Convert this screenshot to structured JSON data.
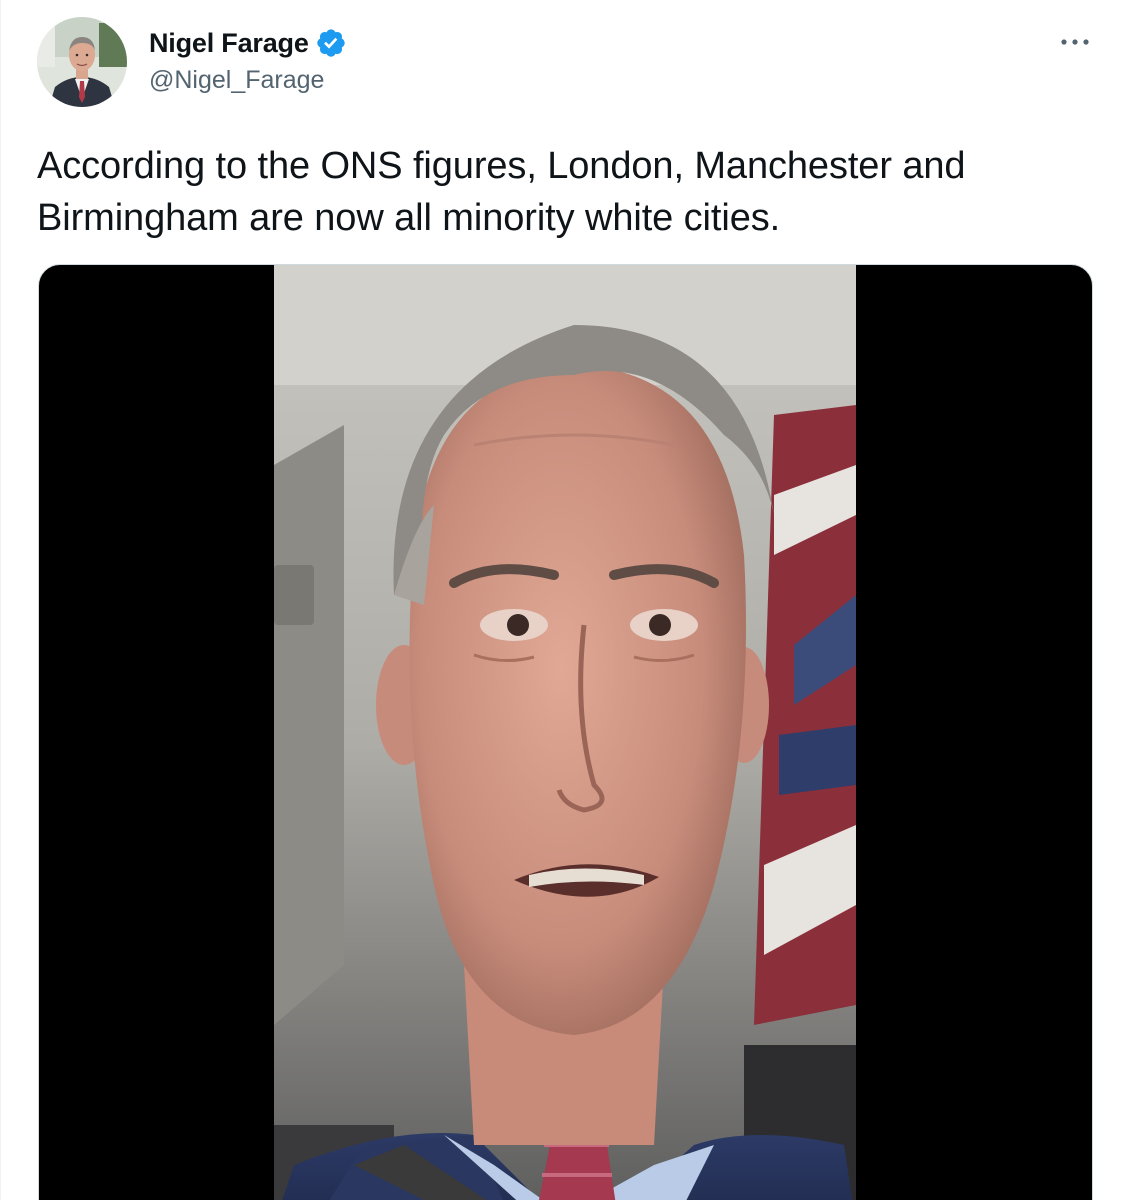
{
  "author": {
    "display_name": "Nigel Farage",
    "handle": "@Nigel_Farage",
    "verified": true,
    "avatar_icon": "profile-photo"
  },
  "menu": {
    "more_icon": "more-horizontal-icon"
  },
  "tweet": {
    "text": "According to the ONS figures, London, Manchester and Birmingham are now all minority white cities."
  },
  "media": {
    "type": "video",
    "thumbnail": "man-in-car-selfie-video"
  },
  "colors": {
    "text_primary": "#0f1419",
    "text_secondary": "#536471",
    "verified_blue": "#1d9bf0",
    "media_border": "#cfd9de",
    "media_background": "#000000"
  }
}
